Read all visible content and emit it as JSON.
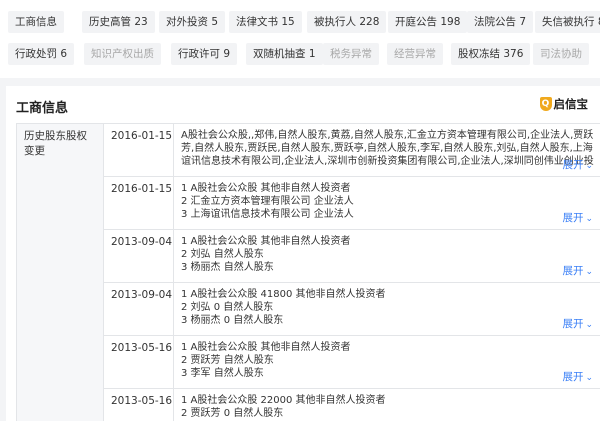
{
  "tabs_row1": [
    {
      "label": "工商信息",
      "disabled": false
    },
    {
      "label": "历史高管 23",
      "disabled": false
    },
    {
      "label": "对外投资 5",
      "disabled": false
    },
    {
      "label": "法律文书 15",
      "disabled": false
    },
    {
      "label": "被执行人 228",
      "disabled": false
    },
    {
      "label": "开庭公告 198",
      "disabled": false
    },
    {
      "label": "法院公告 7",
      "disabled": false
    },
    {
      "label": "失信被执行 8",
      "disabled": false
    }
  ],
  "tabs_row2": [
    {
      "label": "行政处罚 6",
      "disabled": false
    },
    {
      "label": "知识产权出质",
      "disabled": true
    },
    {
      "label": "行政许可 9",
      "disabled": false
    },
    {
      "label": "双随机抽查 1",
      "disabled": false
    },
    {
      "label": "税务异常",
      "disabled": true
    },
    {
      "label": "经营异常",
      "disabled": true
    },
    {
      "label": "股权冻结 376",
      "disabled": false
    },
    {
      "label": "司法协助",
      "disabled": true
    }
  ],
  "section": {
    "title": "工商信息",
    "brand": "启信宝"
  },
  "field_label": "历史股东股权变更",
  "expand_label": "展开",
  "records": [
    {
      "date": "2016-01-15",
      "paragraph": "A股社会公众股,,郑伟,自然人股东,黄荔,自然人股东,汇金立方资本管理有限公司,企业法人,贾跃芳,自然人股东,贾跃民,自然人股东,贾跃亭,自然人股东,李军,自然人股东,刘弘,自然人股东,上海谊讯信息技术有限公司,企业法人,深圳市创新投资集团有限公司,企业法人,深圳同创伟业创业投资有限公司"
    },
    {
      "date": "2016-01-15",
      "lines": [
        "1 A股社会公众股 其他非自然人投资者",
        "2 汇金立方资本管理有限公司 企业法人",
        "3 上海谊讯信息技术有限公司 企业法人"
      ]
    },
    {
      "date": "2013-09-04",
      "lines": [
        "1 A股社会公众股 其他非自然人投资者",
        "2 刘弘 自然人股东",
        "3 杨丽杰 自然人股东"
      ]
    },
    {
      "date": "2013-09-04",
      "lines": [
        "1 A股社会公众股 41800 其他非自然人投资者",
        "2 刘弘 0 自然人股东",
        "3 杨丽杰 0 自然人股东"
      ]
    },
    {
      "date": "2013-05-16",
      "lines": [
        "1 A股社会公众股 其他非自然人投资者",
        "2 贾跃芳 自然人股东",
        "3 李军 自然人股东"
      ]
    },
    {
      "date": "2013-05-16",
      "lines": [
        "1 A股社会公众股 22000 其他非自然人投资者",
        "2 贾跃芳 0 自然人股东"
      ]
    }
  ]
}
